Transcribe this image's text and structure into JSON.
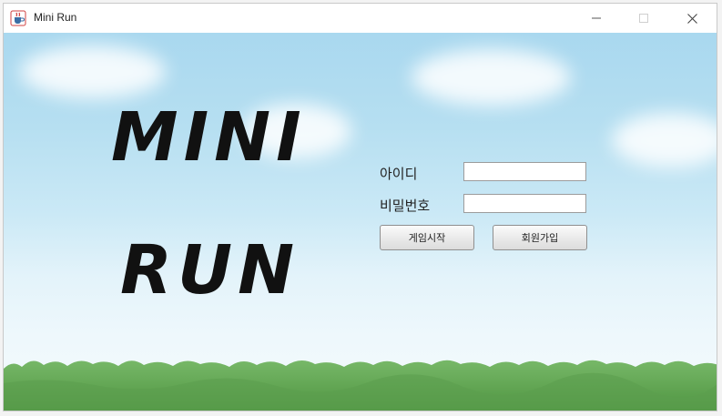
{
  "window": {
    "title": "Mini Run",
    "icon": "java-cup-icon",
    "controls": [
      "minimize-icon",
      "maximize-icon",
      "close-icon"
    ]
  },
  "logo": {
    "line1": "MINI",
    "line2": "RUN"
  },
  "login": {
    "id_label": "아이디",
    "id_value": "",
    "password_label": "비밀번호",
    "password_value": "",
    "start_button": "게임시작",
    "signup_button": "회원가입"
  },
  "colors": {
    "sky_top": "#a9d8ef",
    "sky_bottom": "#f4fbfd",
    "grass": "#5a9e4a"
  }
}
